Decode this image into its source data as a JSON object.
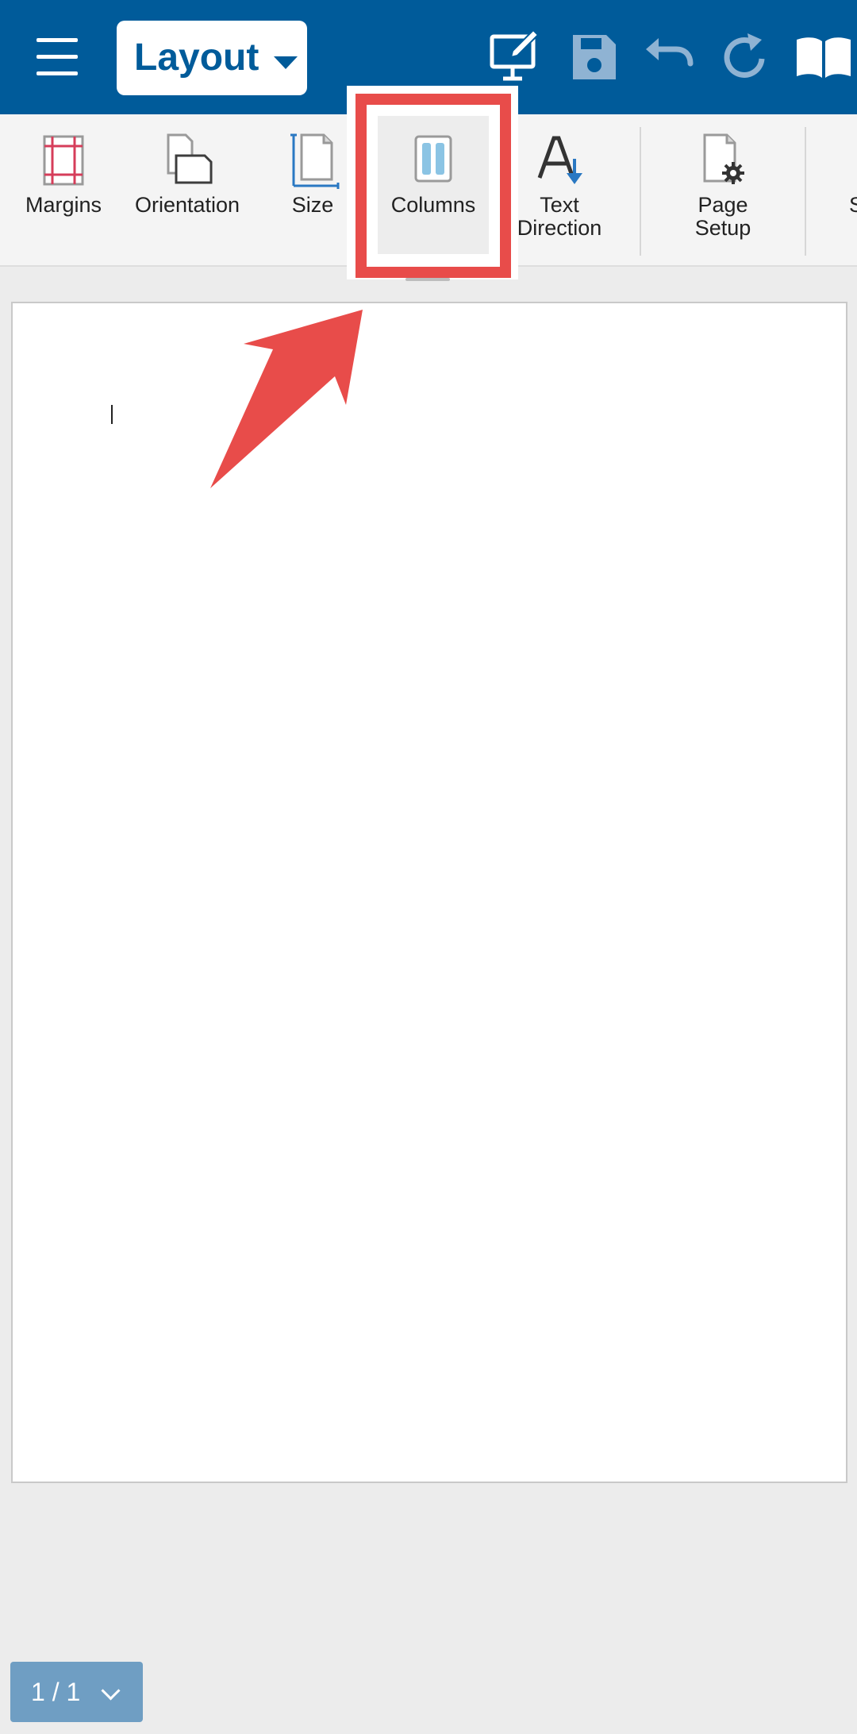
{
  "app_bar": {
    "mode_selector": {
      "label": "Layout"
    },
    "icons": [
      "edit-mode-icon",
      "save-icon",
      "undo-icon",
      "redo-icon",
      "read-mode-icon"
    ],
    "color": "#005b9a"
  },
  "ribbon": {
    "items": [
      {
        "label": "Margins",
        "icon": "margins-icon"
      },
      {
        "label": "Orientation",
        "icon": "orientation-icon"
      },
      {
        "label": "Size",
        "icon": "size-icon"
      },
      {
        "label": "Columns",
        "icon": "columns-icon",
        "highlighted": true
      },
      {
        "label": "Text\nDirection",
        "icon": "text-direction-icon"
      },
      {
        "label": "Page\nSetup",
        "icon": "page-setup-icon"
      },
      {
        "label": "S",
        "icon": "",
        "clipped": true
      }
    ]
  },
  "annotation": {
    "color": "#e84c4a"
  },
  "page_indicator": {
    "label": "1 / 1"
  }
}
